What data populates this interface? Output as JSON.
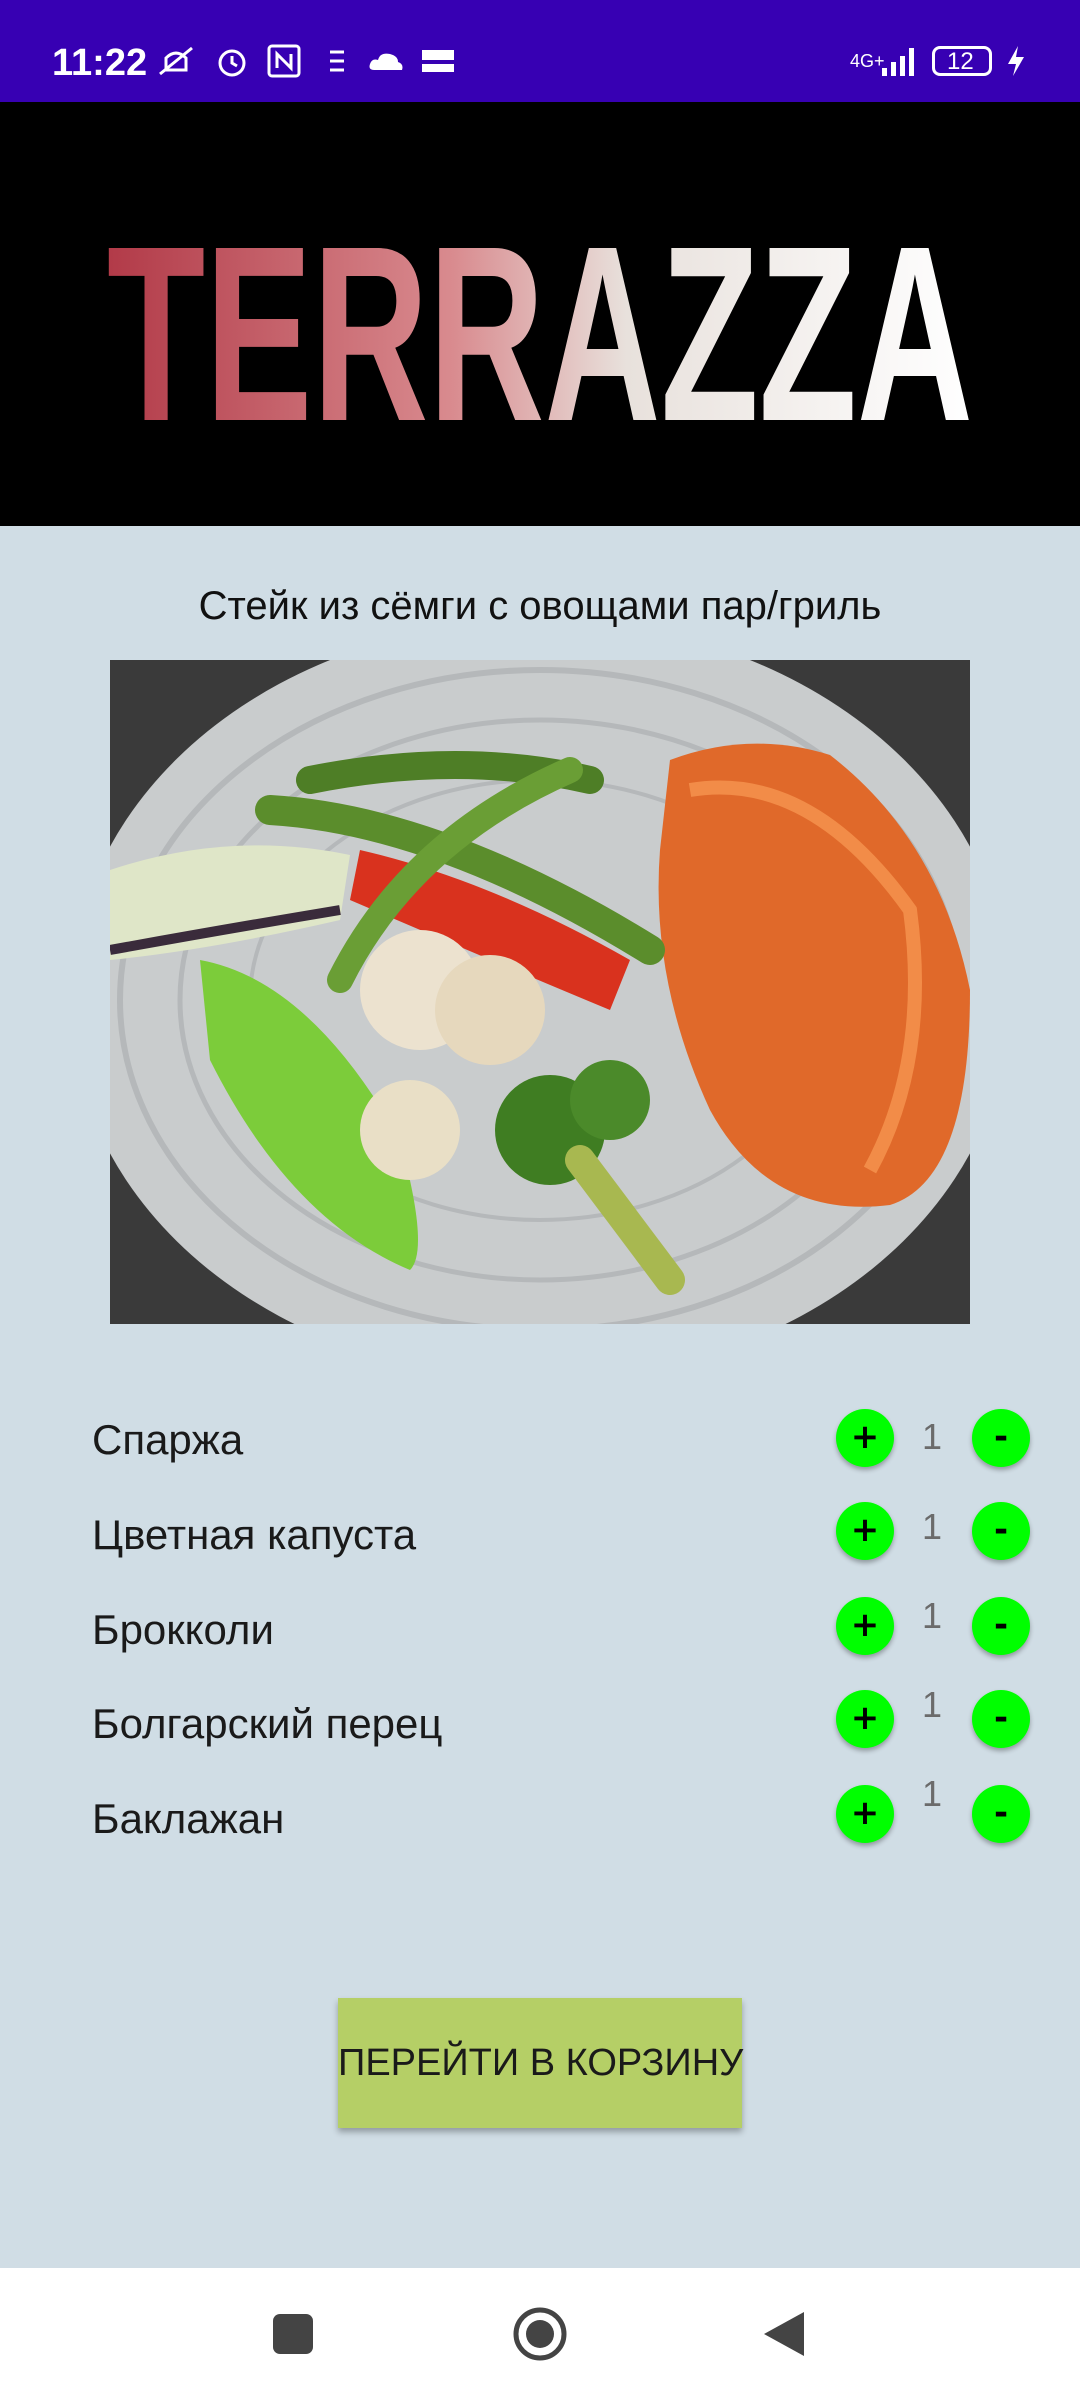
{
  "status_bar": {
    "time": "11:22",
    "network": "4G+",
    "battery": "12"
  },
  "brand": {
    "name": "TERRAZZA"
  },
  "dish": {
    "title": "Стейк из сёмги с овощами пар/гриль"
  },
  "ingredients": [
    {
      "name": "Спаржа",
      "qty": "1",
      "plus": "+",
      "minus": "-"
    },
    {
      "name": "Цветная капуста",
      "qty": "1",
      "plus": "+",
      "minus": "-"
    },
    {
      "name": "Брокколи",
      "qty": "1",
      "plus": "+",
      "minus": "-"
    },
    {
      "name": "Болгарский перец",
      "qty": "1",
      "plus": "+",
      "minus": "-"
    },
    {
      "name": "Баклажан",
      "qty": "1",
      "plus": "+",
      "minus": "-"
    }
  ],
  "cart_button": {
    "label": "ПЕРЕЙТИ В КОРЗИНУ"
  },
  "colors": {
    "status_bar": "#3700b3",
    "background": "#d0dde5",
    "round_button": "#00ff00",
    "cart_button": "#b5cf66"
  },
  "icons": [
    "mute-icon",
    "alarm-icon",
    "nfc-icon",
    "cloud-icon",
    "signal-icon",
    "battery-icon",
    "charging-icon",
    "recents-icon",
    "home-icon",
    "back-icon"
  ]
}
